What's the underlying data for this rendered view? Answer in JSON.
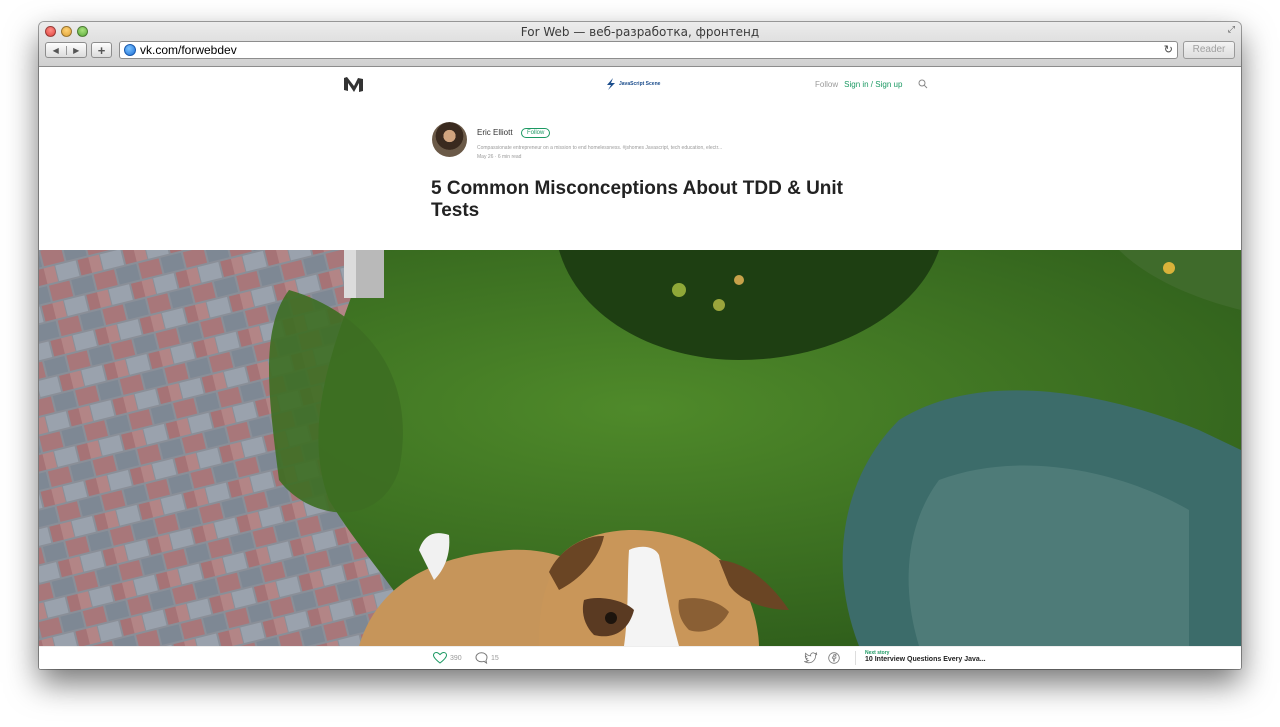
{
  "browser": {
    "window_title": "For Web — веб-разработка, фронтенд",
    "url": "vk.com/forwebdev",
    "reader_label": "Reader"
  },
  "header": {
    "publication_name": "JavaScript Scene",
    "follow_label": "Follow",
    "signin_label": "Sign in / Sign up"
  },
  "author": {
    "name": "Eric Elliott",
    "follow_button": "Follow",
    "bio": "Compassionate entrepreneur on a mission to end homelessness. #jshomes Javascript, tech education, electr...",
    "meta": "May 26 · 6 min read"
  },
  "article": {
    "title": "5 Common Misconceptions About TDD & Unit Tests"
  },
  "footer": {
    "likes": "390",
    "responses": "15",
    "next_label": "Next story",
    "next_title": "10 Interview Questions Every Java..."
  },
  "colors": {
    "accent": "#1c9963"
  }
}
